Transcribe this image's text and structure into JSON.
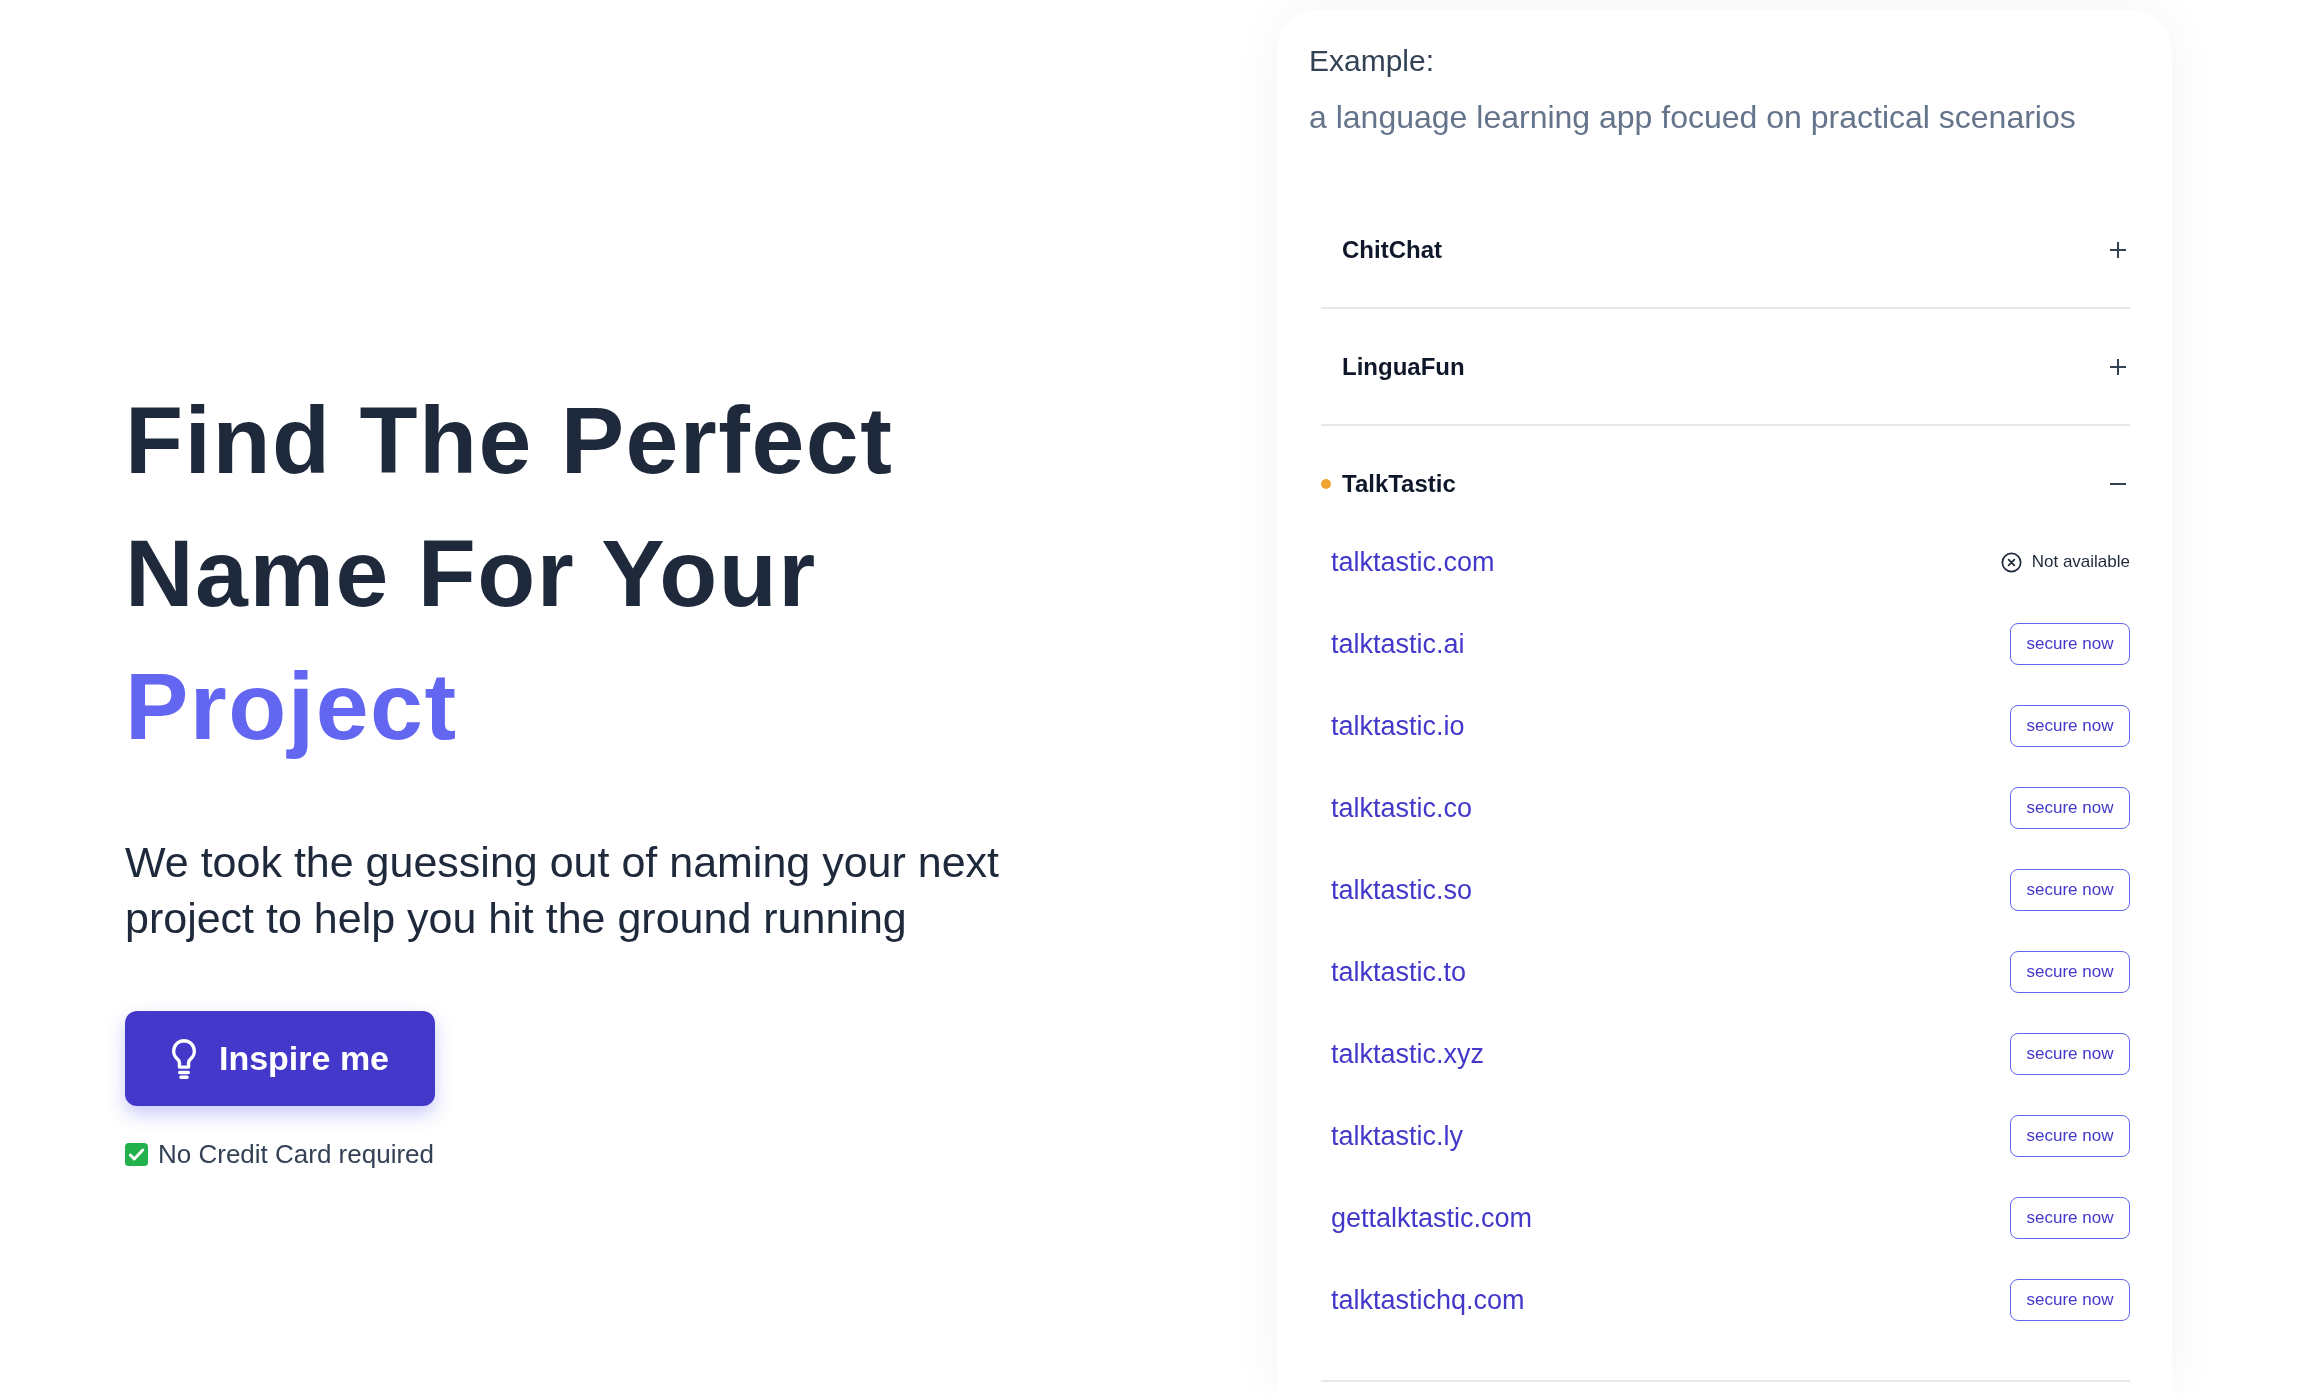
{
  "hero": {
    "headline": "Find The Perfect Name For Your",
    "headline_highlight": "Project",
    "subheading": "We took the guessing out of naming your next project to help you hit the ground running",
    "button": "Inspire me",
    "note": "No Credit Card required"
  },
  "example": {
    "label": "Example:",
    "description": "a language learning app focued on practical scenarios"
  },
  "names": [
    {
      "name": "ChitChat",
      "selected": false,
      "expanded": false
    },
    {
      "name": "LinguaFun",
      "selected": false,
      "expanded": false
    },
    {
      "name": "TalkTastic",
      "selected": true,
      "expanded": true,
      "domains": [
        {
          "domain": "talktastic.com",
          "available": false,
          "status": "Not available"
        },
        {
          "domain": "talktastic.ai",
          "available": true,
          "action": "secure now"
        },
        {
          "domain": "talktastic.io",
          "available": true,
          "action": "secure now"
        },
        {
          "domain": "talktastic.co",
          "available": true,
          "action": "secure now"
        },
        {
          "domain": "talktastic.so",
          "available": true,
          "action": "secure now"
        },
        {
          "domain": "talktastic.to",
          "available": true,
          "action": "secure now"
        },
        {
          "domain": "talktastic.xyz",
          "available": true,
          "action": "secure now"
        },
        {
          "domain": "talktastic.ly",
          "available": true,
          "action": "secure now"
        },
        {
          "domain": "gettalktastic.com",
          "available": true,
          "action": "secure now"
        },
        {
          "domain": "talktastichq.com",
          "available": true,
          "action": "secure now"
        }
      ]
    }
  ]
}
